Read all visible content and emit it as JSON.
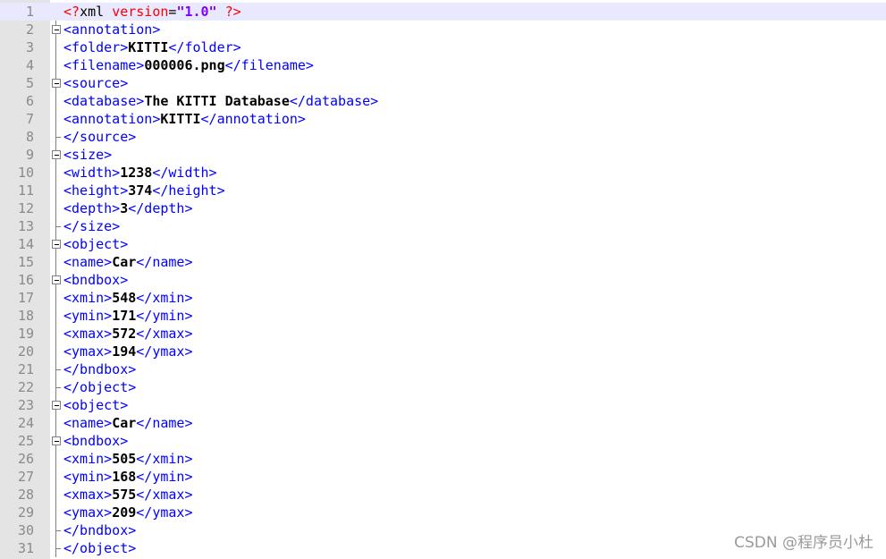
{
  "lines": [
    {
      "n": "1",
      "fold": "none",
      "current": true,
      "decl": {
        "open": "<?",
        "name": "xml",
        "attr": "version",
        "eq": "=",
        "val": "\"1.0\"",
        "close": " ?>"
      }
    },
    {
      "n": "2",
      "fold": "box",
      "open": "<annotation>"
    },
    {
      "n": "3",
      "fold": "line",
      "open": "<folder>",
      "value": "KITTI",
      "close": "</folder>"
    },
    {
      "n": "4",
      "fold": "line",
      "open": "<filename>",
      "value": "000006.png",
      "close": "</filename>"
    },
    {
      "n": "5",
      "fold": "box",
      "open": "<source>"
    },
    {
      "n": "6",
      "fold": "line",
      "open": "<database>",
      "value": "The KITTI Database",
      "close": "</database>"
    },
    {
      "n": "7",
      "fold": "line",
      "open": "<annotation>",
      "value": "KITTI",
      "close": "</annotation>"
    },
    {
      "n": "8",
      "fold": "end",
      "close": "</source>"
    },
    {
      "n": "9",
      "fold": "box",
      "open": "<size>"
    },
    {
      "n": "10",
      "fold": "line",
      "open": "<width>",
      "value": "1238",
      "close": "</width>"
    },
    {
      "n": "11",
      "fold": "line",
      "open": "<height>",
      "value": "374",
      "close": "</height>"
    },
    {
      "n": "12",
      "fold": "line",
      "open": "<depth>",
      "value": "3",
      "close": "</depth>"
    },
    {
      "n": "13",
      "fold": "end",
      "close": "</size>"
    },
    {
      "n": "14",
      "fold": "box",
      "open": "<object>"
    },
    {
      "n": "15",
      "fold": "line",
      "open": "<name>",
      "value": "Car",
      "close": "</name>"
    },
    {
      "n": "16",
      "fold": "box",
      "open": "<bndbox>"
    },
    {
      "n": "17",
      "fold": "line",
      "open": "<xmin>",
      "value": "548",
      "close": "</xmin>"
    },
    {
      "n": "18",
      "fold": "line",
      "open": "<ymin>",
      "value": "171",
      "close": "</ymin>"
    },
    {
      "n": "19",
      "fold": "line",
      "open": "<xmax>",
      "value": "572",
      "close": "</xmax>"
    },
    {
      "n": "20",
      "fold": "line",
      "open": "<ymax>",
      "value": "194",
      "close": "</ymax>"
    },
    {
      "n": "21",
      "fold": "end",
      "close": "</bndbox>"
    },
    {
      "n": "22",
      "fold": "end",
      "close": "</object>"
    },
    {
      "n": "23",
      "fold": "box",
      "open": "<object>"
    },
    {
      "n": "24",
      "fold": "line",
      "open": "<name>",
      "value": "Car",
      "close": "</name>"
    },
    {
      "n": "25",
      "fold": "box",
      "open": "<bndbox>"
    },
    {
      "n": "26",
      "fold": "line",
      "open": "<xmin>",
      "value": "505",
      "close": "</xmin>"
    },
    {
      "n": "27",
      "fold": "line",
      "open": "<ymin>",
      "value": "168",
      "close": "</ymin>"
    },
    {
      "n": "28",
      "fold": "line",
      "open": "<xmax>",
      "value": "575",
      "close": "</xmax>"
    },
    {
      "n": "29",
      "fold": "line",
      "open": "<ymax>",
      "value": "209",
      "close": "</ymax>"
    },
    {
      "n": "30",
      "fold": "end",
      "close": "</bndbox>"
    },
    {
      "n": "31",
      "fold": "end",
      "close": "</object>"
    }
  ],
  "watermark": "CSDN @程序员小杜",
  "colors": {
    "tag": "#0000ff",
    "text": "#000000",
    "declaration": "#ff0000",
    "attribute_value": "#8000ff",
    "gutter": "#e4e4e4",
    "line_number": "#8a8a8a",
    "current_line": "#e8e8ff"
  }
}
